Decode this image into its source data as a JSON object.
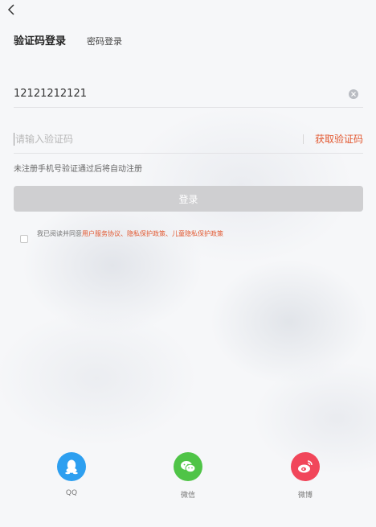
{
  "tabs": {
    "active": "验证码登录",
    "other": "密码登录"
  },
  "phone": {
    "value": "12121212121"
  },
  "code": {
    "placeholder": "请输入验证码",
    "get_code": "获取验证码"
  },
  "hint": "未注册手机号验证通过后将自动注册",
  "login_button": "登录",
  "agreement": {
    "prefix": "我已阅读并同意",
    "user_agreement": "用户服务协议",
    "sep1": "、",
    "privacy": "隐私保护政策",
    "sep2": "、",
    "child_privacy": "儿童隐私保护政策"
  },
  "social": [
    {
      "label": "QQ",
      "icon": "qq-icon",
      "color": "#2d9ff0"
    },
    {
      "label": "微信",
      "icon": "wechat-icon",
      "color": "#4fc447"
    },
    {
      "label": "微博",
      "icon": "weibo-icon",
      "color": "#f1465a"
    }
  ],
  "colors": {
    "accent": "#e2572f",
    "button_disabled": "#cfcfd1"
  }
}
